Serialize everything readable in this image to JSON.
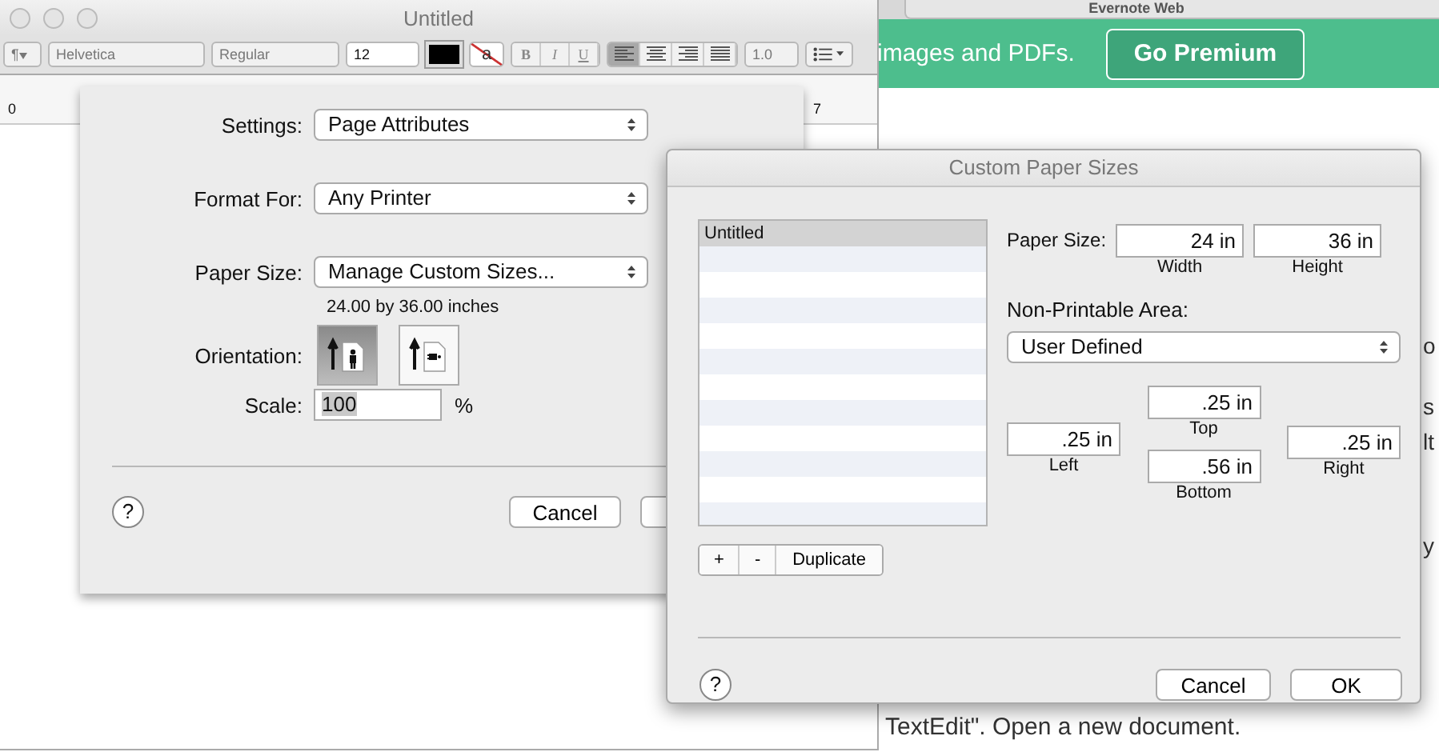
{
  "background_page": {
    "tab_title": "Evernote Web",
    "banner_text": "images and PDFs.",
    "banner_button": "Go Premium",
    "text_fragments": [
      "o",
      "s",
      "lt",
      "y"
    ],
    "bottom_text": "TextEdit\". Open a new document."
  },
  "textedit": {
    "title": "Untitled",
    "toolbar": {
      "paragraph": "¶",
      "font": "Helvetica",
      "style": "Regular",
      "size": "12",
      "highlight_glyph": "a",
      "format_buttons": [
        {
          "label": "B",
          "kind": "bold"
        },
        {
          "label": "I",
          "kind": "italic"
        },
        {
          "label": "U",
          "kind": "underline"
        }
      ],
      "alignments": [
        {
          "kind": "left",
          "selected": true
        },
        {
          "kind": "center",
          "selected": false
        },
        {
          "kind": "right",
          "selected": false
        },
        {
          "kind": "justify",
          "selected": false
        }
      ],
      "spacing": "1.0"
    },
    "ruler": {
      "labels": [
        "0",
        "7"
      ]
    }
  },
  "page_setup": {
    "rows": [
      {
        "label": "Settings:",
        "value": "Page Attributes"
      },
      {
        "label": "Format For:",
        "value": "Any Printer"
      },
      {
        "label": "Paper Size:",
        "value": "Manage Custom Sizes..."
      }
    ],
    "paper_note": "24.00 by 36.00 inches",
    "orientation": {
      "label": "Orientation:",
      "options": [
        {
          "kind": "portrait",
          "selected": true
        },
        {
          "kind": "landscape",
          "selected": false
        }
      ]
    },
    "scale": {
      "label": "Scale:",
      "value": "100",
      "unit": "%"
    },
    "help_glyph": "?",
    "cancel_button": "Cancel"
  },
  "custom_sizes": {
    "title": "Custom Paper Sizes",
    "list": [
      {
        "label": "Untitled",
        "selected": true
      }
    ],
    "list_buttons": [
      "+",
      "-",
      "Duplicate"
    ],
    "paper_size": {
      "label": "Paper Size:",
      "width": "24 in",
      "width_caption": "Width",
      "height": "36 in",
      "height_caption": "Height"
    },
    "non_printable": {
      "label": "Non-Printable Area:",
      "value": "User Defined",
      "top_value": ".25 in",
      "top_caption": "Top",
      "left_value": ".25 in",
      "left_caption": "Left",
      "right_value": ".25 in",
      "right_caption": "Right",
      "bottom_value": ".56 in",
      "bottom_caption": "Bottom"
    },
    "help_glyph": "?",
    "buttons": [
      "Cancel",
      "OK"
    ]
  }
}
